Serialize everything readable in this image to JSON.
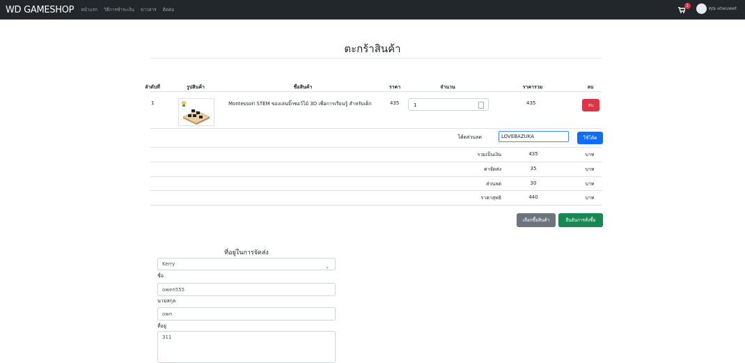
{
  "navbar": {
    "brand": "WD GAMESHOP",
    "links": [
      "หน้าแรก",
      "วิธีการชำระเงิน",
      "ข่าวสาร",
      "ติดต่อ"
    ],
    "cart_count": "1",
    "user": "คุณ etwuwet"
  },
  "page": {
    "title": "ตะกร้าสินค้า"
  },
  "table": {
    "headers": [
      "ลำดับที่",
      "รูปสินค้า",
      "ชื่อสินค้า",
      "ราคา",
      "จำนวน",
      "ราคารวม",
      "ลบ"
    ],
    "row": {
      "index": "1",
      "name": "Montessori STEM ของเล่นจิ๊กซอว์ไม้ 3D เพื่อการเรียนรู้ สำหรับเด็ก",
      "price": "435",
      "quantity": "1",
      "total": "435",
      "delete_label": "ลบ"
    }
  },
  "coupon": {
    "label": "โค้ดส่วนลด",
    "value": "LOVEBAZUKA",
    "apply_label": "ใช้โค้ด"
  },
  "summary": [
    {
      "label": "รวมเป็นเงิน",
      "value": "435",
      "unit": "บาท"
    },
    {
      "label": "ค่าจัดส่ง",
      "value": "35",
      "unit": "บาท"
    },
    {
      "label": "ส่วนลด",
      "value": "30",
      "unit": "บาท"
    },
    {
      "label": "ราคาสุทธิ",
      "value": "440",
      "unit": "บาท"
    }
  ],
  "actions": {
    "continue_label": "เลือกซื้อสินค้า",
    "confirm_label": "ยืนยันการสั่งซื้อ"
  },
  "address": {
    "title": "ที่อยู่ในการจัดส่ง",
    "carrier": "Kerry",
    "first_name_label": "ชื่อ",
    "first_name": "owen555",
    "last_name_label": "นามสกุล",
    "last_name": "own",
    "address_label": "ที่อยู่",
    "address": "311"
  },
  "colors": {
    "navbar": "#23272b",
    "danger": "#dc3545",
    "primary": "#0d6efd",
    "secondary": "#6c757d",
    "success": "#198754"
  }
}
